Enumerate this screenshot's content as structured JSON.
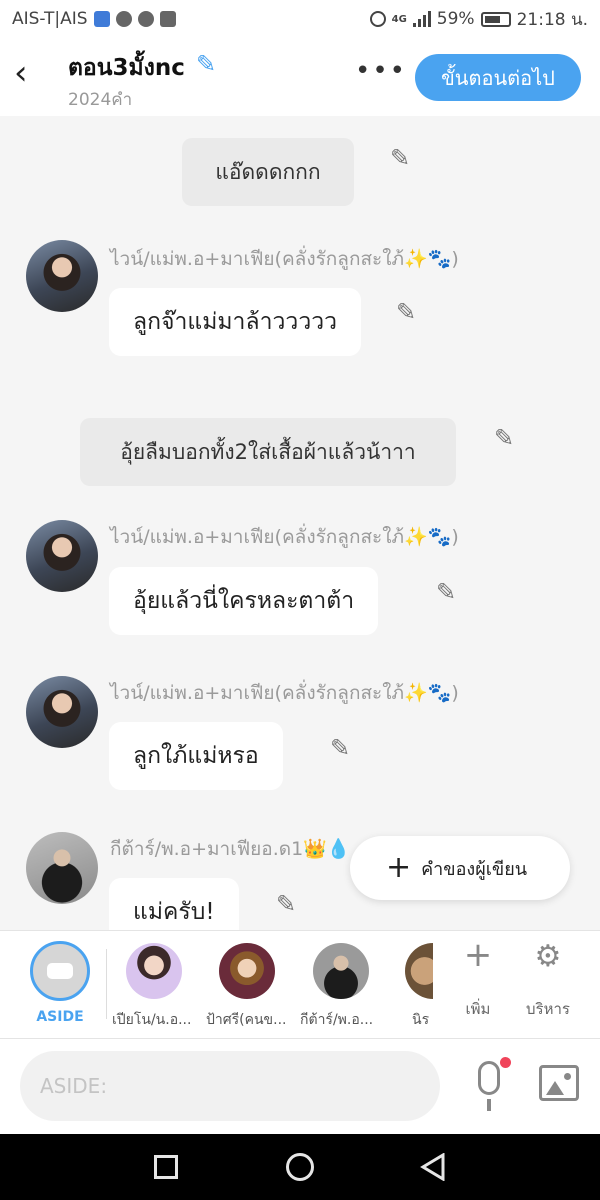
{
  "status": {
    "carrier": "AIS-T|AIS",
    "battery": "59%",
    "network": "4G",
    "time": "21:18 น."
  },
  "header": {
    "title": "ตอน3มั้งnc",
    "word_count": "2024คำ",
    "more_label": "•••",
    "next_button": "ขั้นตอนต่อไป"
  },
  "messages": [
    {
      "type": "narration",
      "text": "แอ๊ดดดกกก"
    },
    {
      "type": "chat",
      "sender": "ไวน์/แม่พ.อ+มาเฟีย(คลั่งรักลูกสะใภ้✨🐾)",
      "text": "ลูกจ๊าแม่มาล้าววววว"
    },
    {
      "type": "narration",
      "text": "อุ้ยลืมบอกทั้ง2ใส่เสื้อผ้าแล้วน้าาา"
    },
    {
      "type": "chat",
      "sender": "ไวน์/แม่พ.อ+มาเฟีย(คลั่งรักลูกสะใภ้✨🐾)",
      "text": "อุ้ยแล้วนี่ใครหละตาต้า"
    },
    {
      "type": "chat",
      "sender": "ไวน์/แม่พ.อ+มาเฟีย(คลั่งรักลูกสะใภ้✨🐾)",
      "text": "ลูกใภ้แม่หรอ"
    },
    {
      "type": "chat",
      "sender": "กีต้าร์/พ.อ+มาเฟียอ.ด1👑💧",
      "text": "แม่ครับ!"
    }
  ],
  "fab": {
    "label": "คำของผู้เขียน"
  },
  "characters": {
    "aside_label": "ASIDE",
    "items": [
      {
        "name": "เปียโน/น.อ..."
      },
      {
        "name": "ป้าศรี(คนข..."
      },
      {
        "name": "กีต้าร์/พ.อ..."
      },
      {
        "name": "นิร"
      }
    ],
    "add_label": "เพิ่ม",
    "manage_label": "บริหาร"
  },
  "input": {
    "placeholder": "ASIDE:"
  }
}
